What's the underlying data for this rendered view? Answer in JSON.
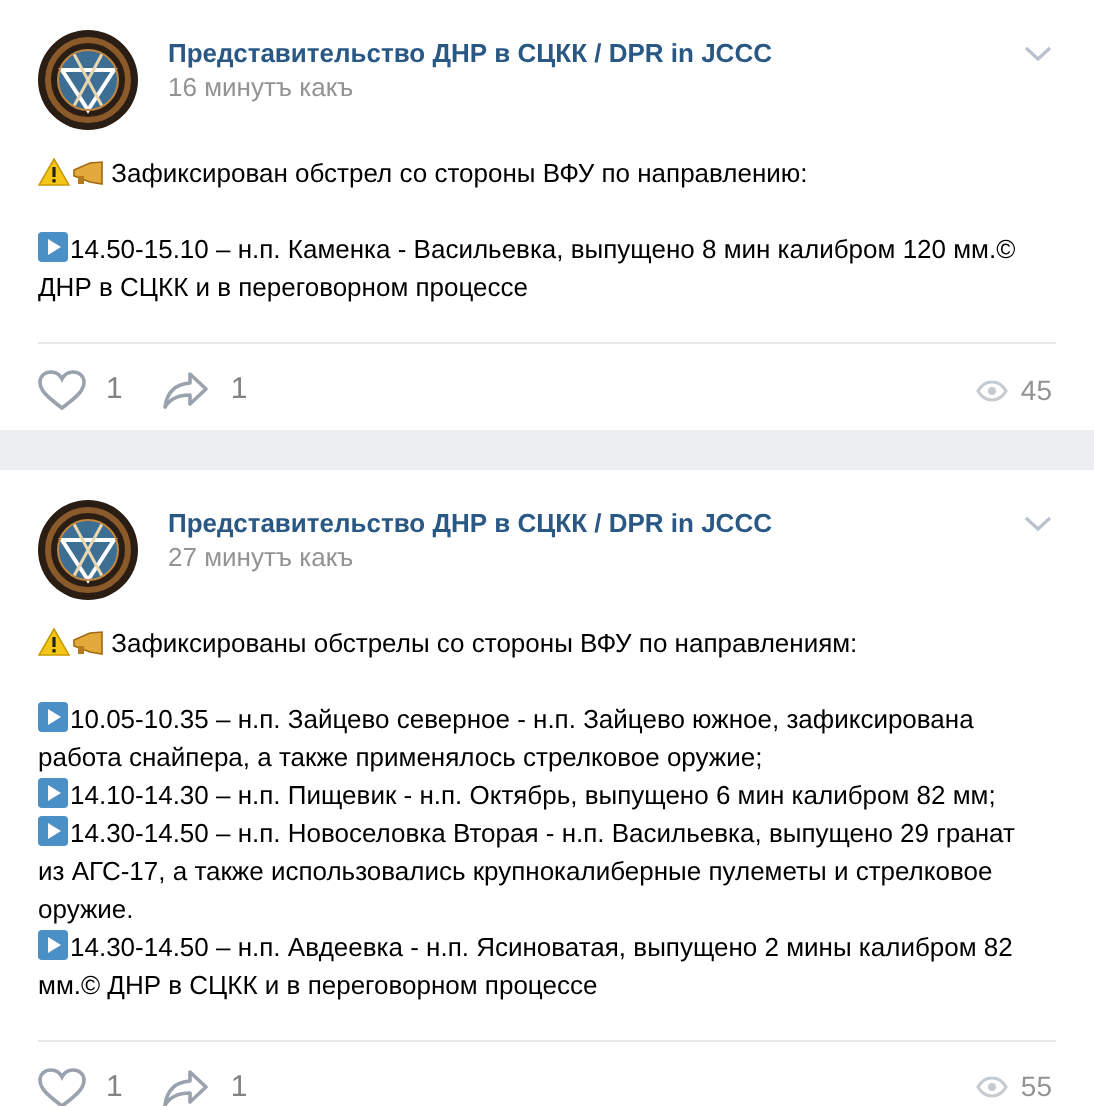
{
  "posts": [
    {
      "author": "Представительство ДНР в СЦКК / DPR in JCCC",
      "time": "16 минутъ какъ",
      "body": [
        {
          "kind": "alert",
          "text": "Зафиксирован обстрел со стороны ВФУ по направлению:"
        },
        {
          "kind": "item",
          "text": "14.50-15.10 – н.п. Каменка - Васильевка, выпущено 8 мин калибром 120 мм.© ДНР в СЦКК и в переговорном процессе"
        }
      ],
      "likes": "1",
      "shares": "1",
      "views": "45"
    },
    {
      "author": "Представительство ДНР в СЦКК / DPR in JCCC",
      "time": "27 минутъ какъ",
      "body": [
        {
          "kind": "alert",
          "text": "Зафиксированы обстрелы со стороны ВФУ по направлениям:"
        },
        {
          "kind": "item",
          "text": "10.05-10.35 – н.п. Зайцево северное - н.п. Зайцево южное, зафиксирована работа снайпера, а также применялось стрелковое оружие;"
        },
        {
          "kind": "item",
          "text": "14.10-14.30 – н.п. Пищевик - н.п. Октябрь, выпущено 6 мин калибром 82 мм;"
        },
        {
          "kind": "item",
          "text": "14.30-14.50 – н.п. Новоселовка Вторая - н.п. Васильевка, выпущено 29 гранат из АГС-17, а также использовались крупнокалиберные пулеметы и стрелковое оружие."
        },
        {
          "kind": "item",
          "text": "14.30-14.50 – н.п. Авдеевка - н.п. Ясиноватая, выпущено 2 мины калибром 82 мм.© ДНР в СЦКК и в переговорном процессе"
        }
      ],
      "likes": "1",
      "shares": "1",
      "views": "55"
    }
  ]
}
